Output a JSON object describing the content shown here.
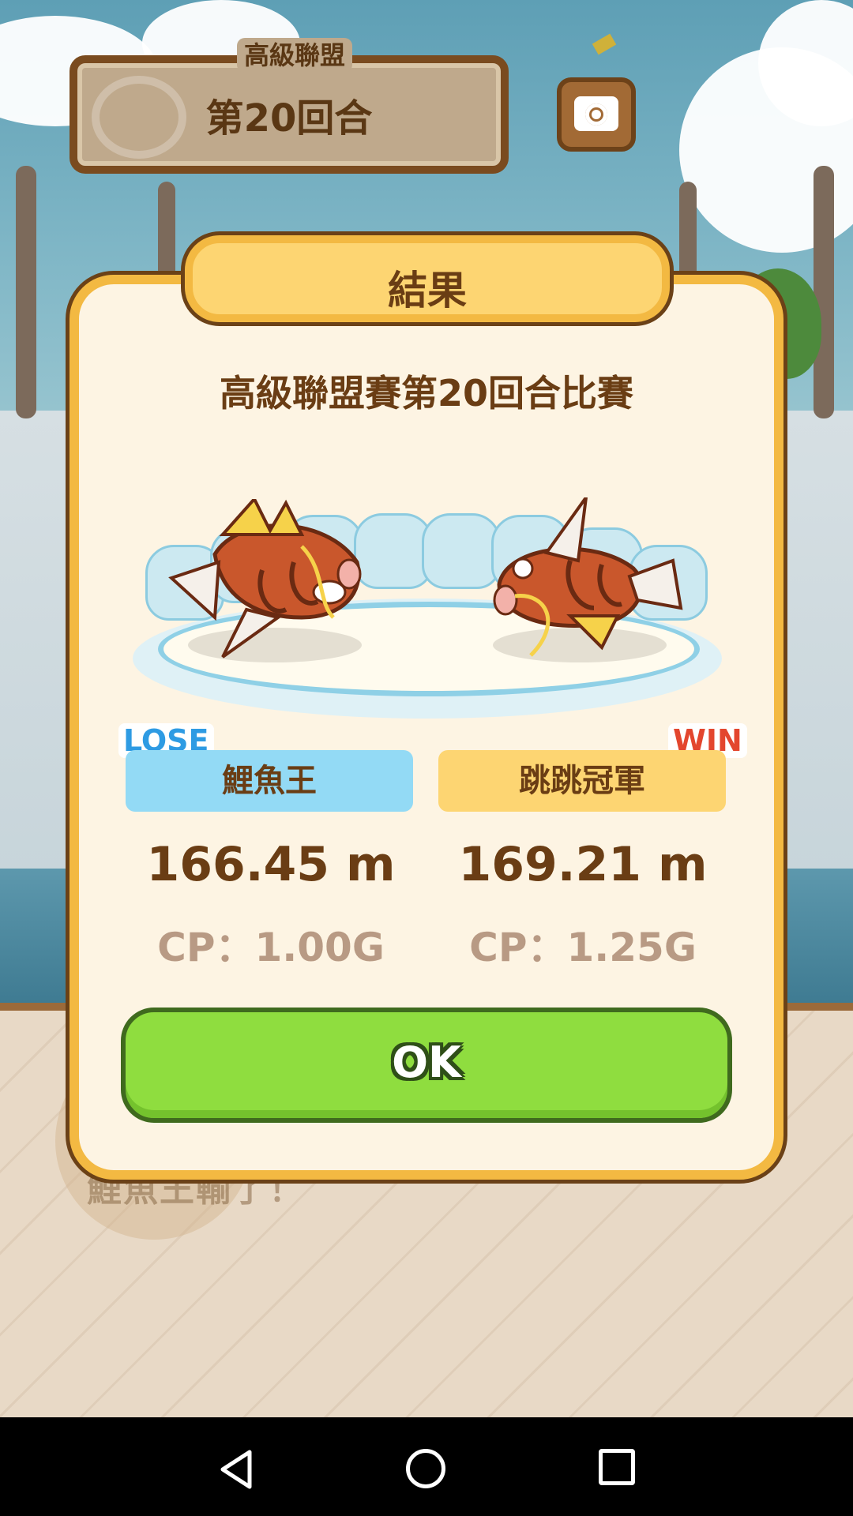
{
  "header": {
    "league_label": "高級聯盟",
    "round_label": "第20回合",
    "camera_icon": "camera-icon"
  },
  "dialog": {
    "title": "結果",
    "match_title": "高級聯盟賽第20回合比賽",
    "left": {
      "status": "LOSE",
      "name": "鯉魚王",
      "distance": "166.45 m",
      "cp": "CP：1.00G"
    },
    "right": {
      "status": "WIN",
      "name": "跳跳冠軍",
      "distance": "169.21 m",
      "cp": "CP：1.25G"
    },
    "ok_label": "OK"
  },
  "background": {
    "partial_text": "鯉魚王輸了！"
  },
  "colors": {
    "lose": "#2e9be3",
    "win": "#e3462e",
    "ok_button": "#8fdd3f",
    "dialog_border": "#f3b942"
  },
  "navbar": {
    "icons": [
      "back-icon",
      "home-icon",
      "recent-apps-icon"
    ]
  }
}
